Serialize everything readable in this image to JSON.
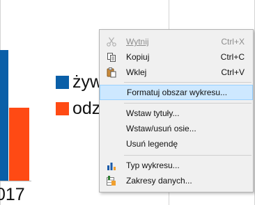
{
  "chart": {
    "legend": [
      {
        "label": "żyw",
        "color": "#0a5fa8"
      },
      {
        "label": "odz",
        "color": "#ff4a14"
      }
    ],
    "x_label": "017"
  },
  "context_menu": {
    "items": [
      {
        "label": "Wytnij",
        "shortcut": "Ctrl+X",
        "icon": "scissors-icon",
        "disabled": true
      },
      {
        "label": "Kopiuj",
        "shortcut": "Ctrl+C",
        "icon": "copy-icon",
        "disabled": false
      },
      {
        "label": "Wklej",
        "shortcut": "Ctrl+V",
        "icon": "paste-icon",
        "disabled": false
      },
      {
        "label": "Formatuj obszar wykresu...",
        "shortcut": "",
        "icon": "",
        "highlighted": true
      },
      {
        "label": "Wstaw tytuły...",
        "shortcut": "",
        "icon": ""
      },
      {
        "label": "Wstaw/usuń osie...",
        "shortcut": "",
        "icon": ""
      },
      {
        "label": "Usuń legendę",
        "shortcut": "",
        "icon": ""
      },
      {
        "label": "Typ wykresu...",
        "shortcut": "",
        "icon": "chart-type-icon"
      },
      {
        "label": "Zakresy danych...",
        "shortcut": "",
        "icon": "data-ranges-icon"
      }
    ]
  }
}
